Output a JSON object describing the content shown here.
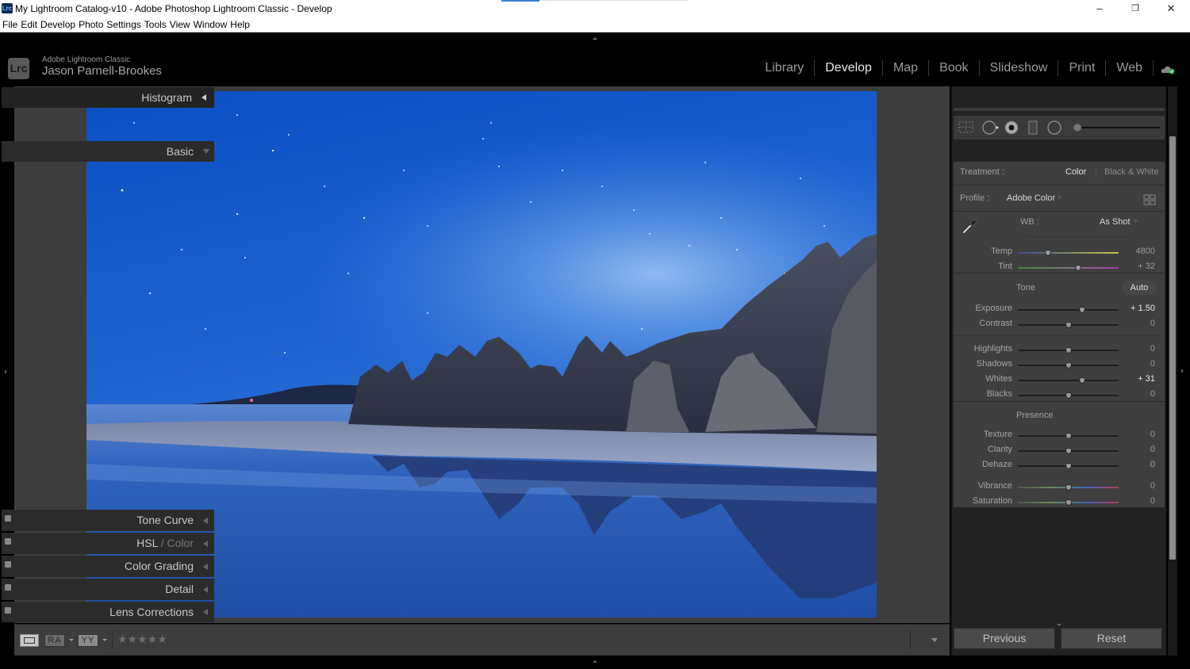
{
  "window": {
    "title": "My Lightroom Catalog-v10 - Adobe Photoshop Lightroom Classic - Develop",
    "app_icon_text": "Lrc",
    "minimize": "–",
    "restore": "❐",
    "close": "✕"
  },
  "menu": [
    "File",
    "Edit",
    "Develop",
    "Photo",
    "Settings",
    "Tools",
    "View",
    "Window",
    "Help"
  ],
  "identity": {
    "logo": "Lrc",
    "product": "Adobe Lightroom Classic",
    "user": "Jason Parnell-Brookes"
  },
  "modules": [
    {
      "label": "Library",
      "active": false
    },
    {
      "label": "Develop",
      "active": true
    },
    {
      "label": "Map",
      "active": false
    },
    {
      "label": "Book",
      "active": false
    },
    {
      "label": "Slideshow",
      "active": false
    },
    {
      "label": "Print",
      "active": false
    },
    {
      "label": "Web",
      "active": false
    }
  ],
  "toolbar": {
    "view_mode": "loupe",
    "before_after_label": "RA",
    "yy_label": "YY",
    "rating": 0,
    "stars": "★★★★★"
  },
  "panel": {
    "histogram": {
      "title": "Histogram"
    },
    "basic": {
      "title": "Basic",
      "treatment_label": "Treatment :",
      "treatment_options": [
        "Color",
        "Black & White"
      ],
      "treatment_selected": "Color",
      "profile_label": "Profile :",
      "profile_value": "Adobe Color",
      "profile_stepper": "÷",
      "wb_label": "WB :",
      "wb_value": "As Shot",
      "wb_stepper": "÷",
      "tone_label": "Tone",
      "auto_label": "Auto",
      "presence_label": "Presence",
      "sliders": [
        {
          "name": "Temp",
          "value": "4800",
          "position": 0.3,
          "bright": false
        },
        {
          "name": "Tint",
          "value": "+ 32",
          "position": 0.6,
          "bright": false
        },
        {
          "name": "Exposure",
          "value": "+ 1.50",
          "position": 0.64,
          "bright": true
        },
        {
          "name": "Contrast",
          "value": "0",
          "position": 0.5,
          "bright": false
        },
        {
          "name": "Highlights",
          "value": "0",
          "position": 0.5,
          "bright": false
        },
        {
          "name": "Shadows",
          "value": "0",
          "position": 0.5,
          "bright": false
        },
        {
          "name": "Whites",
          "value": "+ 31",
          "position": 0.64,
          "bright": true
        },
        {
          "name": "Blacks",
          "value": "0",
          "position": 0.5,
          "bright": false
        },
        {
          "name": "Texture",
          "value": "0",
          "position": 0.5,
          "bright": false
        },
        {
          "name": "Clarity",
          "value": "0",
          "position": 0.5,
          "bright": false
        },
        {
          "name": "Dehaze",
          "value": "0",
          "position": 0.5,
          "bright": false
        },
        {
          "name": "Vibrance",
          "value": "0",
          "position": 0.5,
          "bright": false
        },
        {
          "name": "Saturation",
          "value": "0",
          "position": 0.5,
          "bright": false
        }
      ]
    },
    "collapsed_sections": [
      {
        "title": "Tone Curve"
      },
      {
        "title": "HSL",
        "suffix": " / Color"
      },
      {
        "title": "Color Grading"
      },
      {
        "title": "Detail"
      },
      {
        "title": "Lens Corrections"
      }
    ],
    "buttons": {
      "previous": "Previous",
      "reset": "Reset"
    }
  }
}
